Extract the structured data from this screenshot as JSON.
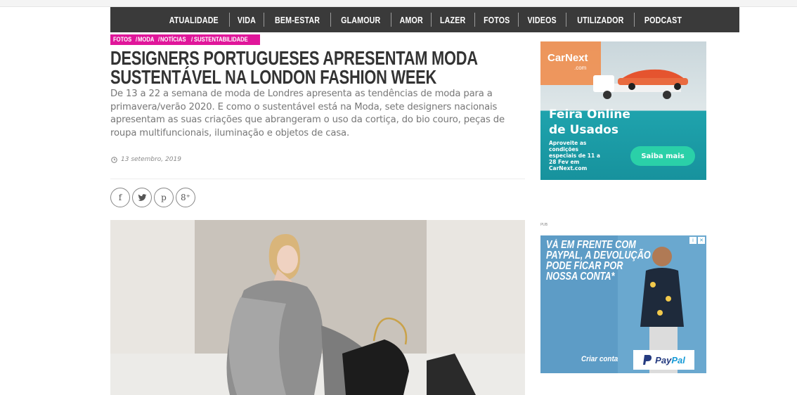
{
  "nav": {
    "items": [
      "ATUALIDADE",
      "VIDA",
      "BEM-ESTAR",
      "GLAMOUR",
      "AMOR",
      "LAZER",
      "FOTOS",
      "VIDEOS",
      "UTILIZADOR",
      "PODCAST"
    ]
  },
  "article": {
    "categories": [
      "FOTOS",
      "MODA",
      "NOTÍCIAS",
      "SUSTENTABILIDADE"
    ],
    "title_line1": "DESIGNERS PORTUGUESES APRESENTAM MODA",
    "title_line2": "SUSTENTÁVEL NA LONDON FASHION WEEK",
    "lead": "De 13 a 22 a semana de moda de Londres apresenta as tendências de moda para a primavera/verão 2020. E como o sustentável está na Moda, sete designers nacionais apresentam as suas criações que abrangeram o uso da cortiça, do bio couro, peças de roupa multifuncionais, iluminação e objetos de casa.",
    "date": "13 setembro, 2019"
  },
  "share": {
    "icons": [
      "facebook-icon",
      "twitter-icon",
      "pinterest-icon",
      "google-plus-icon"
    ],
    "glyphs": [
      "f",
      "",
      "p",
      "8⁺"
    ]
  },
  "ad_carnext": {
    "brand": "CarNext",
    "brand_sub": ".com",
    "headline_line1": "Feira Online",
    "headline_line2": "de Usados",
    "small_text": "Aproveite as condições especiais de 11 a 28 Fev em CarNext.com",
    "cta": "Saiba mais"
  },
  "pub_label": "PUB",
  "ad_paypal": {
    "line1": "VÁ EM FRENTE COM",
    "line2": "PAYPAL, A DEVOLUÇÃO",
    "line3": "PODE FICAR POR",
    "line4": "NOSSA CONTA*",
    "cta": "Criar conta",
    "brand_part1": "Pay",
    "brand_part2": "Pal"
  },
  "colors": {
    "nav_bg": "#3a3a3a",
    "category_bg": "#e0169a",
    "carnext_teal": "#17929d",
    "paypal_blue": "#253b80"
  }
}
